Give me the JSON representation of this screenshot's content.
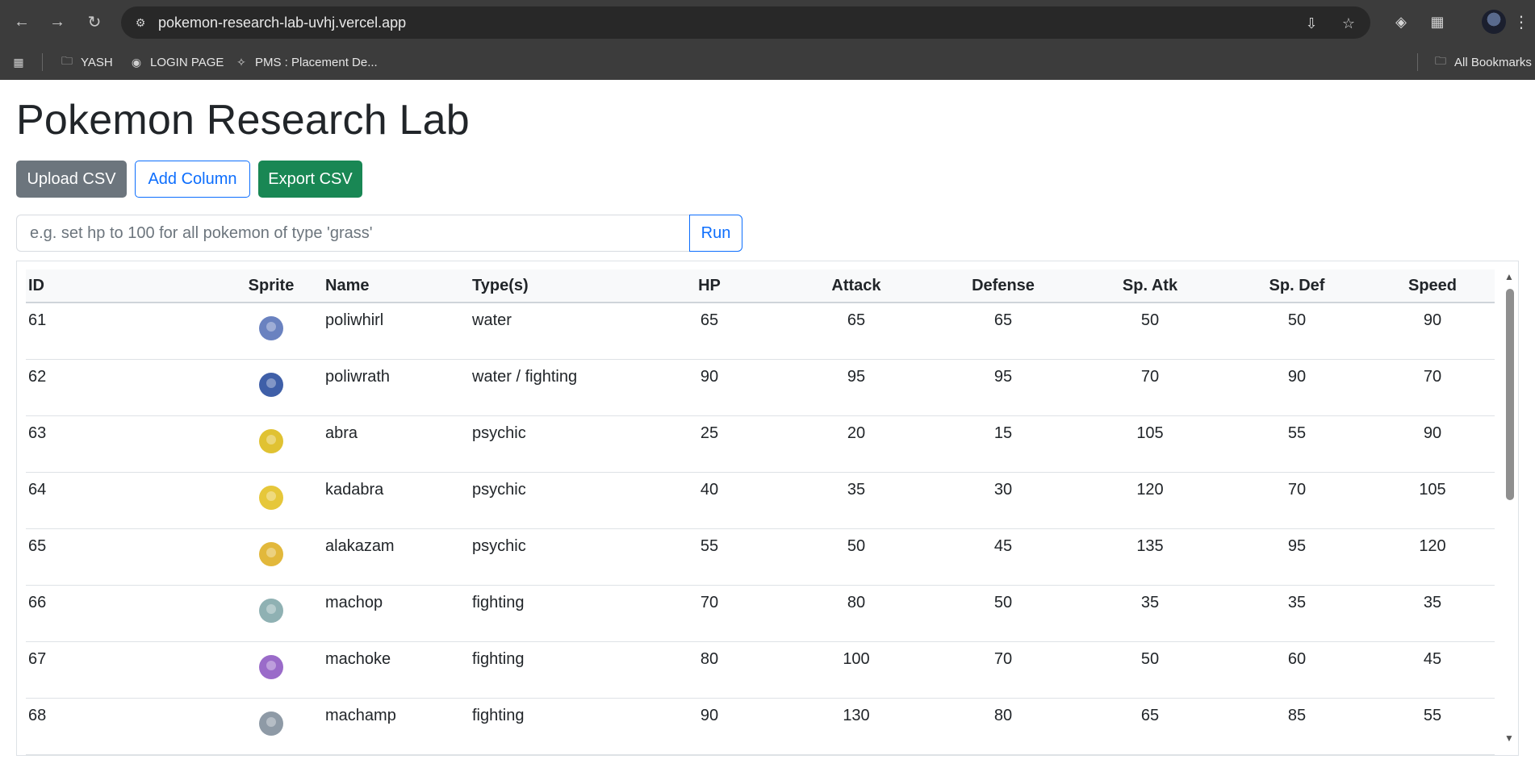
{
  "browser": {
    "url": "pokemon-research-lab-uvhj.vercel.app",
    "bookmarks": [
      "YASH",
      "LOGIN PAGE",
      "PMS : Placement De..."
    ],
    "all_bookmarks": "All Bookmarks"
  },
  "page": {
    "title": "Pokemon Research Lab",
    "buttons": {
      "upload": "Upload CSV",
      "add_column": "Add Column",
      "export": "Export CSV"
    },
    "command": {
      "placeholder": "e.g. set hp to 100 for all pokemon of type 'grass'",
      "run": "Run"
    }
  },
  "table": {
    "headers": [
      "ID",
      "Sprite",
      "Name",
      "Type(s)",
      "HP",
      "Attack",
      "Defense",
      "Sp. Atk",
      "Sp. Def",
      "Speed"
    ],
    "rows": [
      {
        "id": "61",
        "sprite_color": "#6a82c0",
        "name": "poliwhirl",
        "types": "water",
        "hp": "65",
        "attack": "65",
        "defense": "65",
        "sp_atk": "50",
        "sp_def": "50",
        "speed": "90"
      },
      {
        "id": "62",
        "sprite_color": "#3f5fa8",
        "name": "poliwrath",
        "types": "water / fighting",
        "hp": "90",
        "attack": "95",
        "defense": "95",
        "sp_atk": "70",
        "sp_def": "90",
        "speed": "70"
      },
      {
        "id": "63",
        "sprite_color": "#e0c232",
        "name": "abra",
        "types": "psychic",
        "hp": "25",
        "attack": "20",
        "defense": "15",
        "sp_atk": "105",
        "sp_def": "55",
        "speed": "90"
      },
      {
        "id": "64",
        "sprite_color": "#e6c73a",
        "name": "kadabra",
        "types": "psychic",
        "hp": "40",
        "attack": "35",
        "defense": "30",
        "sp_atk": "120",
        "sp_def": "70",
        "speed": "105"
      },
      {
        "id": "65",
        "sprite_color": "#e2b83b",
        "name": "alakazam",
        "types": "psychic",
        "hp": "55",
        "attack": "50",
        "defense": "45",
        "sp_atk": "135",
        "sp_def": "95",
        "speed": "120"
      },
      {
        "id": "66",
        "sprite_color": "#8fb1b3",
        "name": "machop",
        "types": "fighting",
        "hp": "70",
        "attack": "80",
        "defense": "50",
        "sp_atk": "35",
        "sp_def": "35",
        "speed": "35"
      },
      {
        "id": "67",
        "sprite_color": "#9a6bc9",
        "name": "machoke",
        "types": "fighting",
        "hp": "80",
        "attack": "100",
        "defense": "70",
        "sp_atk": "50",
        "sp_def": "60",
        "speed": "45"
      },
      {
        "id": "68",
        "sprite_color": "#8e9aa6",
        "name": "machamp",
        "types": "fighting",
        "hp": "90",
        "attack": "130",
        "defense": "80",
        "sp_atk": "65",
        "sp_def": "85",
        "speed": "55"
      }
    ]
  }
}
